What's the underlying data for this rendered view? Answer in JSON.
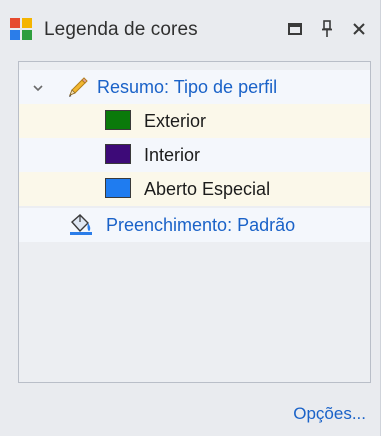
{
  "window": {
    "title": "Legenda de cores",
    "buttons": {
      "restore_icon": "window-restore-icon",
      "pin_icon": "pin-icon",
      "close_icon": "close-icon"
    }
  },
  "legend": {
    "summary": {
      "label": "Resumo: Tipo de perfil",
      "icon": "pencil-icon",
      "expanded": true,
      "items": [
        {
          "label": "Exterior",
          "color": "#0a7a0a"
        },
        {
          "label": "Interior",
          "color": "#3d0a78"
        },
        {
          "label": "Aberto Especial",
          "color": "#1f7cf0"
        }
      ]
    },
    "fill": {
      "label": "Preenchimento: Padrão",
      "icon": "paint-bucket-icon"
    }
  },
  "footer": {
    "options_label": "Opções..."
  },
  "colors": {
    "link": "#1a62c8",
    "panel_background": "#e9ebef"
  }
}
